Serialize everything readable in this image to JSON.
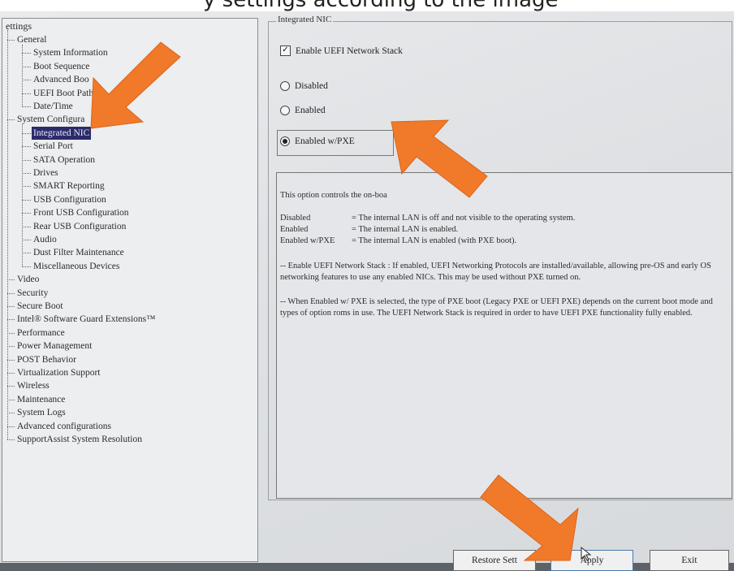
{
  "tree": {
    "root_label": "ettings",
    "items": [
      {
        "label": "General",
        "indent": 1
      },
      {
        "label": "System Information",
        "indent": 2
      },
      {
        "label": "Boot Sequence",
        "indent": 2
      },
      {
        "label": "Advanced Boo",
        "indent": 2
      },
      {
        "label": "UEFI Boot Path",
        "indent": 2
      },
      {
        "label": "Date/Time",
        "indent": 2
      },
      {
        "label": "System Configura",
        "indent": 1
      },
      {
        "label": "Integrated NIC",
        "indent": 2,
        "selected": true
      },
      {
        "label": "Serial Port",
        "indent": 2
      },
      {
        "label": "SATA Operation",
        "indent": 2
      },
      {
        "label": "Drives",
        "indent": 2
      },
      {
        "label": "SMART Reporting",
        "indent": 2
      },
      {
        "label": "USB Configuration",
        "indent": 2
      },
      {
        "label": "Front USB Configuration",
        "indent": 2
      },
      {
        "label": "Rear USB Configuration",
        "indent": 2
      },
      {
        "label": "Audio",
        "indent": 2
      },
      {
        "label": "Dust Filter Maintenance",
        "indent": 2
      },
      {
        "label": "Miscellaneous Devices",
        "indent": 2
      },
      {
        "label": "Video",
        "indent": 1
      },
      {
        "label": "Security",
        "indent": 1
      },
      {
        "label": "Secure Boot",
        "indent": 1
      },
      {
        "label": "Intel® Software Guard Extensions™",
        "indent": 1
      },
      {
        "label": "Performance",
        "indent": 1
      },
      {
        "label": "Power Management",
        "indent": 1
      },
      {
        "label": "POST Behavior",
        "indent": 1
      },
      {
        "label": "Virtualization Support",
        "indent": 1
      },
      {
        "label": "Wireless",
        "indent": 1
      },
      {
        "label": "Maintenance",
        "indent": 1
      },
      {
        "label": "System Logs",
        "indent": 1
      },
      {
        "label": "Advanced configurations",
        "indent": 1
      },
      {
        "label": "SupportAssist System Resolution",
        "indent": 1
      }
    ]
  },
  "panel": {
    "legend": "Integrated NIC",
    "checkbox_label": "Enable UEFI Network Stack",
    "checkbox_checked": true,
    "radios": [
      {
        "label": "Disabled",
        "checked": false
      },
      {
        "label": "Enabled",
        "checked": false
      },
      {
        "label": "Enabled w/PXE",
        "checked": true
      }
    ]
  },
  "help": {
    "intro": "This option controls the on-boa",
    "rows": [
      {
        "term": "Disabled",
        "desc": "= The internal LAN is off and not visible to the operating system."
      },
      {
        "term": "Enabled",
        "desc": "= The internal LAN is enabled."
      },
      {
        "term": "Enabled w/PXE",
        "desc": "= The internal LAN is enabled (with PXE boot)."
      }
    ],
    "para1": "-- Enable UEFI Network Stack : If enabled, UEFI Networking Protocols are installed/available, allowing pre-OS and early OS networking features to use any enabled NICs. This may be used without PXE turned on.",
    "para2": "-- When Enabled w/ PXE is selected, the type of PXE boot (Legacy PXE or UEFI PXE) depends on the current boot mode and types of option roms in use. The UEFI Network Stack is required in order to have UEFI PXE functionality fully enabled."
  },
  "buttons": {
    "restore": "Restore Sett",
    "apply": "Apply",
    "exit": "Exit"
  },
  "colors": {
    "arrow": "#f07a2a",
    "selected_bg": "#2b2b6a"
  },
  "caption_partial": "y settings according to the image"
}
